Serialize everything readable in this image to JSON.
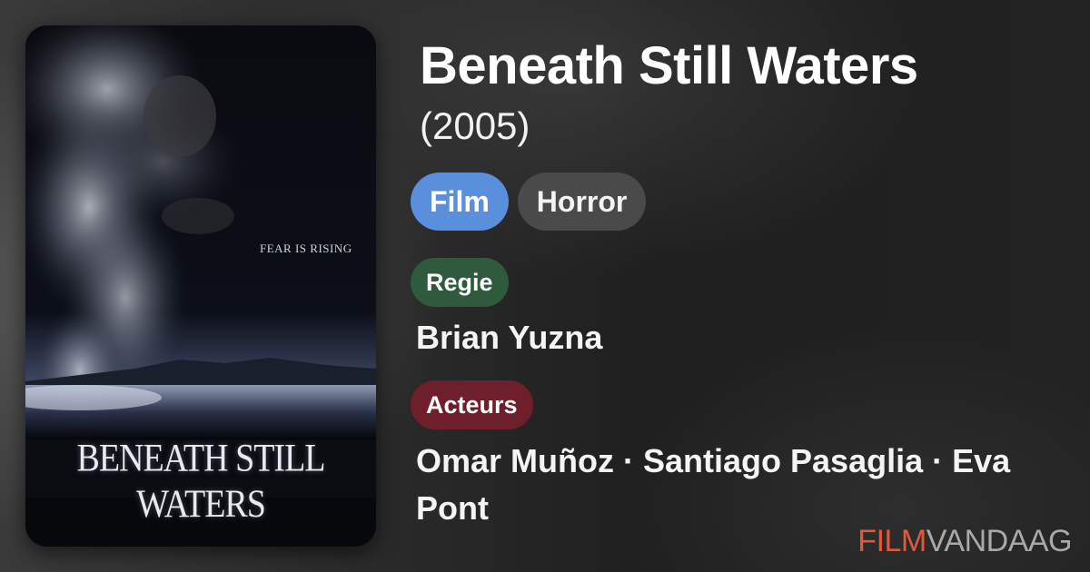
{
  "movie": {
    "title": "Beneath Still Waters",
    "year": "(2005)"
  },
  "tags": {
    "type": "Film",
    "genre": "Horror"
  },
  "director": {
    "label": "Regie",
    "name": "Brian Yuzna"
  },
  "cast": {
    "label": "Acteurs",
    "names": "Omar Muñoz · Santiago Pasaglia · Eva Pont"
  },
  "poster": {
    "tagline": "FEAR IS RISING",
    "title": "BENEATH STILL WATERS"
  },
  "brand": {
    "part1": "FILM",
    "part2": "VANDAAG"
  },
  "colors": {
    "film_tag": "#5a8fdc",
    "genre_tag": "#4a4a4a",
    "regie_badge": "#2f5b3c",
    "acteurs_badge": "#6e1f2b",
    "brand_accent": "#e05a3a"
  }
}
